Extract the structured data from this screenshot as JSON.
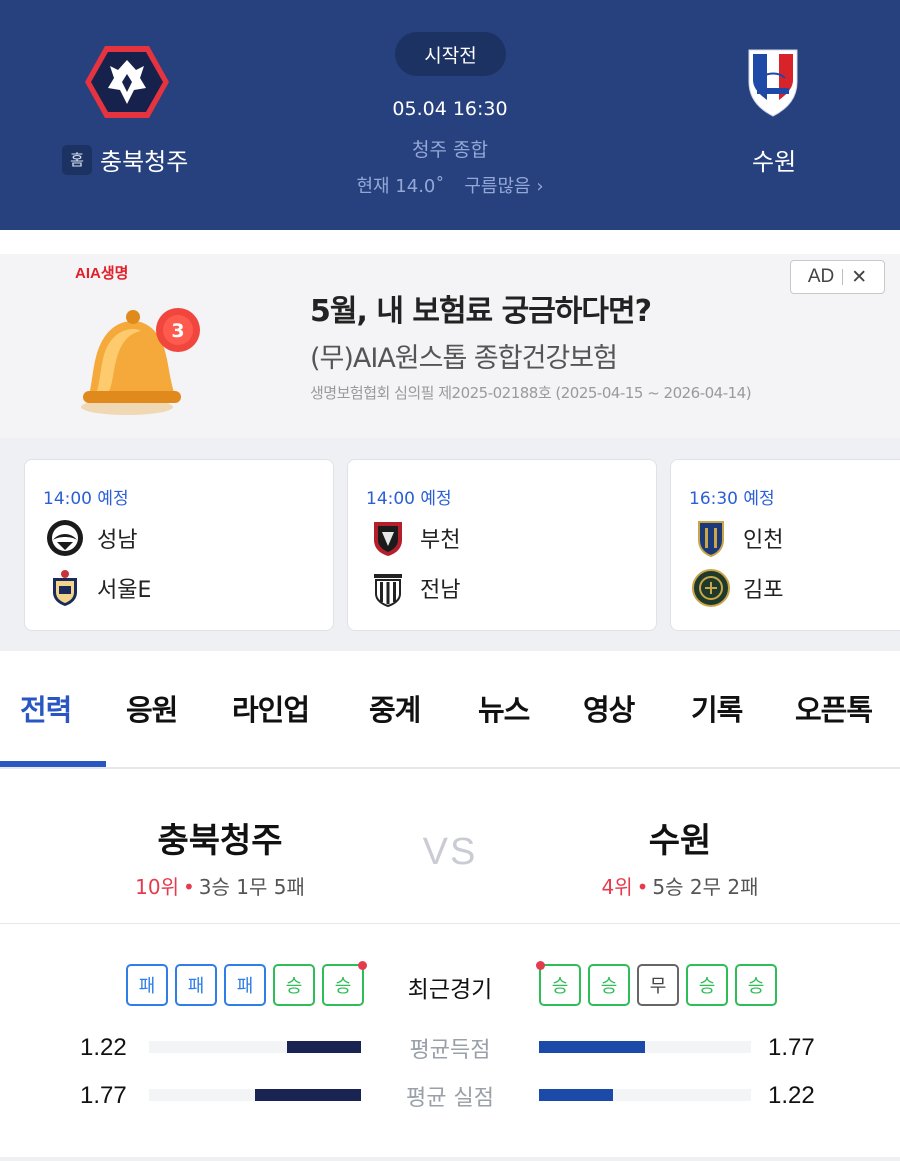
{
  "header": {
    "home_badge": "홈",
    "home_team": "충북청주",
    "away_team": "수원",
    "status": "시작전",
    "datetime": "05.04 16:30",
    "stadium": "청주 종합",
    "weather_temp": "현재 14.0˚",
    "weather_desc": "구름많음 ›"
  },
  "ad": {
    "brand": "AIA생명",
    "bell_count": "3",
    "badge": "AD",
    "close": "✕",
    "title": "5월, 내 보험료 궁금하다면?",
    "subtitle": "(무)AIA원스톱 종합건강보험",
    "note": "생명보험협회 심의필 제2025-02188호 (2025-04-15 ~ 2026-04-14)"
  },
  "games": [
    {
      "time": "14:00 예정",
      "team1": "성남",
      "team2": "서울E"
    },
    {
      "time": "14:00 예정",
      "team1": "부천",
      "team2": "전남"
    },
    {
      "time": "16:30 예정",
      "team1": "인천",
      "team2": "김포"
    }
  ],
  "tabs": [
    "전력",
    "응원",
    "라인업",
    "중계",
    "뉴스",
    "영상",
    "기록",
    "오픈톡"
  ],
  "matchup": {
    "home": {
      "name": "충북청주",
      "rank": "10위",
      "record": "3승 1무 5패"
    },
    "away": {
      "name": "수원",
      "rank": "4위",
      "record": "5승 2무 2패"
    },
    "vs": "VS"
  },
  "recent_form": {
    "label": "최근경기",
    "home": [
      "패",
      "패",
      "패",
      "승",
      "승"
    ],
    "away": [
      "승",
      "승",
      "무",
      "승",
      "승"
    ]
  },
  "stats": [
    {
      "label": "평균득점",
      "home": "1.22",
      "away": "1.77",
      "home_ratio": 0.35,
      "away_ratio": 0.5
    },
    {
      "label": "평균 실점",
      "home": "1.77",
      "away": "1.22",
      "home_ratio": 0.5,
      "away_ratio": 0.35
    }
  ],
  "colors": {
    "header_bg": "#27417f",
    "accent_blue": "#2a56c4",
    "rank_red": "#e53b4f",
    "win_green": "#2ebd56",
    "loss_blue": "#2f7ee8"
  }
}
